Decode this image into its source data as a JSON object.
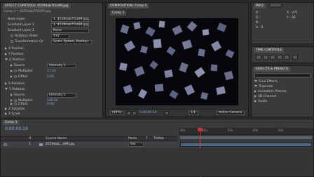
{
  "effect_controls": {
    "tab_label": "EFFECT CONTROLS: 4559dab7f2a99.jpg",
    "layer_path": "Comp 1 • 4559dab7f2a99.jpg",
    "rows": [
      {
        "label": "Back Layer",
        "value": "1. 4559dab7f2a99.jpg"
      },
      {
        "label": "Gradient Layer 1",
        "value": "1. 4559dab7f2a99.jpg"
      },
      {
        "label": "Gradient Layer 2",
        "value": "None"
      },
      {
        "label": "Rotation Order",
        "value": "XYZ"
      },
      {
        "label": "Transformation Or",
        "value": "Scale, Rotate, Position"
      },
      {
        "label": "X Position"
      },
      {
        "label": "Y Position"
      },
      {
        "label": "Z Position"
      },
      {
        "label": "Source",
        "value": "Intensity 1"
      },
      {
        "label": "Multiplier",
        "value": "17.42"
      },
      {
        "label": "Offset",
        "value": "0.00"
      },
      {
        "label": "X Rotation"
      },
      {
        "label": "Y Rotation"
      },
      {
        "label": "Source",
        "value": "Intensity 1"
      },
      {
        "label": "Multiplier",
        "value": "148.00"
      },
      {
        "label": "Offset",
        "value": "0.00"
      },
      {
        "label": "Z Rotation"
      },
      {
        "label": "X Scale"
      }
    ]
  },
  "composition": {
    "tab_label": "COMPOSITION: Comp 1",
    "subtab": "Comp 1",
    "zoom": "(49%)",
    "timecode": "0;00;00;19",
    "resolution": "1/1",
    "camera": "Active Camera"
  },
  "info": {
    "tab_label": "INFO",
    "tab2_label": "AUDIO",
    "values": [
      "R :",
      "G :",
      "B :",
      "A : 0",
      "X : 271",
      "Y : 86"
    ]
  },
  "time_controls": {
    "tab_label": "TIME CONTROLS"
  },
  "effects_presets": {
    "tab_label": "EFFECTS & PRESETS",
    "items": [
      "Final Effects",
      "Trapcode",
      "Animation Presets",
      "3D Channel",
      "Audio"
    ],
    "expanded": [
      "Final Effects",
      "Trapcode"
    ]
  },
  "timeline": {
    "tab_label": "Comp 1",
    "timecode": "0;00;00;19",
    "columns": {
      "num": "#",
      "name": "Source Name",
      "mode": "Mode",
      "t": "T",
      "trkmat": "TrkMat"
    },
    "layer": {
      "num": "1",
      "name": "4559dab...a99.jpg",
      "mode": "Nor"
    },
    "ruler": [
      "00s",
      "01s",
      "02s",
      "03s",
      "04s"
    ]
  },
  "colors": {
    "accent": "#7fa9e2",
    "playhead": "#e2383a",
    "bg": "#2a2a2a",
    "panel": "#3a3a3a"
  }
}
